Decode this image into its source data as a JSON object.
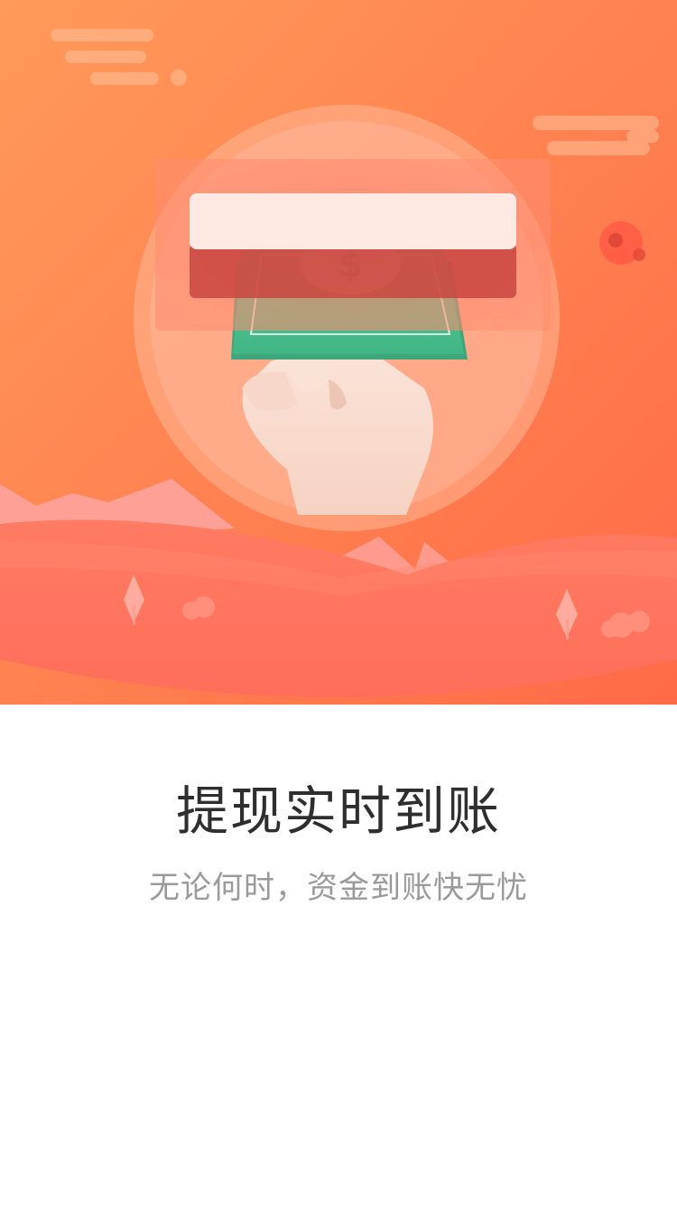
{
  "hero": {
    "illustration": "withdraw-cash-card-slot-illustration",
    "colors": {
      "gradient_start": "#FF9A5A",
      "gradient_end": "#FF6B48",
      "banknote": "#4CC08F",
      "card_slot": "#FF7E6B"
    }
  },
  "onboarding": {
    "title": "提现实时到账",
    "subtitle": "无论何时，资金到账快无忧"
  }
}
